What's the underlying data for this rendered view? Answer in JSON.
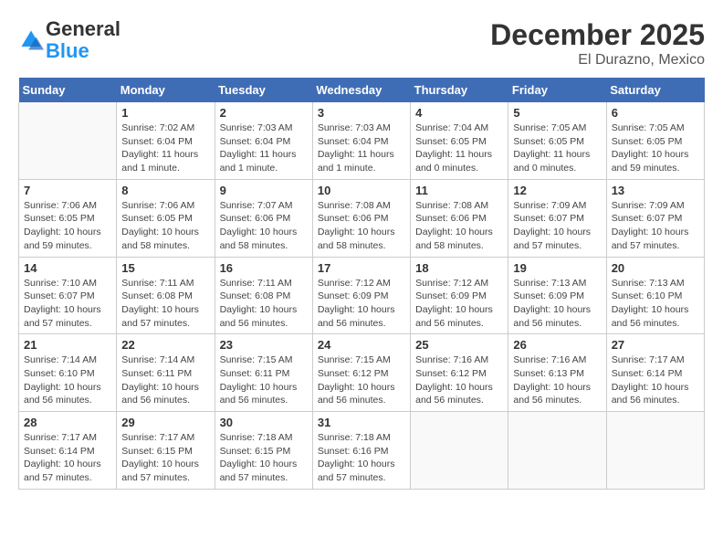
{
  "logo": {
    "general": "General",
    "blue": "Blue"
  },
  "header": {
    "month": "December 2025",
    "location": "El Durazno, Mexico"
  },
  "days_of_week": [
    "Sunday",
    "Monday",
    "Tuesday",
    "Wednesday",
    "Thursday",
    "Friday",
    "Saturday"
  ],
  "weeks": [
    [
      {
        "num": "",
        "info": ""
      },
      {
        "num": "1",
        "info": "Sunrise: 7:02 AM\nSunset: 6:04 PM\nDaylight: 11 hours\nand 1 minute."
      },
      {
        "num": "2",
        "info": "Sunrise: 7:03 AM\nSunset: 6:04 PM\nDaylight: 11 hours\nand 1 minute."
      },
      {
        "num": "3",
        "info": "Sunrise: 7:03 AM\nSunset: 6:04 PM\nDaylight: 11 hours\nand 1 minute."
      },
      {
        "num": "4",
        "info": "Sunrise: 7:04 AM\nSunset: 6:05 PM\nDaylight: 11 hours\nand 0 minutes."
      },
      {
        "num": "5",
        "info": "Sunrise: 7:05 AM\nSunset: 6:05 PM\nDaylight: 11 hours\nand 0 minutes."
      },
      {
        "num": "6",
        "info": "Sunrise: 7:05 AM\nSunset: 6:05 PM\nDaylight: 10 hours\nand 59 minutes."
      }
    ],
    [
      {
        "num": "7",
        "info": "Sunrise: 7:06 AM\nSunset: 6:05 PM\nDaylight: 10 hours\nand 59 minutes."
      },
      {
        "num": "8",
        "info": "Sunrise: 7:06 AM\nSunset: 6:05 PM\nDaylight: 10 hours\nand 58 minutes."
      },
      {
        "num": "9",
        "info": "Sunrise: 7:07 AM\nSunset: 6:06 PM\nDaylight: 10 hours\nand 58 minutes."
      },
      {
        "num": "10",
        "info": "Sunrise: 7:08 AM\nSunset: 6:06 PM\nDaylight: 10 hours\nand 58 minutes."
      },
      {
        "num": "11",
        "info": "Sunrise: 7:08 AM\nSunset: 6:06 PM\nDaylight: 10 hours\nand 58 minutes."
      },
      {
        "num": "12",
        "info": "Sunrise: 7:09 AM\nSunset: 6:07 PM\nDaylight: 10 hours\nand 57 minutes."
      },
      {
        "num": "13",
        "info": "Sunrise: 7:09 AM\nSunset: 6:07 PM\nDaylight: 10 hours\nand 57 minutes."
      }
    ],
    [
      {
        "num": "14",
        "info": "Sunrise: 7:10 AM\nSunset: 6:07 PM\nDaylight: 10 hours\nand 57 minutes."
      },
      {
        "num": "15",
        "info": "Sunrise: 7:11 AM\nSunset: 6:08 PM\nDaylight: 10 hours\nand 57 minutes."
      },
      {
        "num": "16",
        "info": "Sunrise: 7:11 AM\nSunset: 6:08 PM\nDaylight: 10 hours\nand 56 minutes."
      },
      {
        "num": "17",
        "info": "Sunrise: 7:12 AM\nSunset: 6:09 PM\nDaylight: 10 hours\nand 56 minutes."
      },
      {
        "num": "18",
        "info": "Sunrise: 7:12 AM\nSunset: 6:09 PM\nDaylight: 10 hours\nand 56 minutes."
      },
      {
        "num": "19",
        "info": "Sunrise: 7:13 AM\nSunset: 6:09 PM\nDaylight: 10 hours\nand 56 minutes."
      },
      {
        "num": "20",
        "info": "Sunrise: 7:13 AM\nSunset: 6:10 PM\nDaylight: 10 hours\nand 56 minutes."
      }
    ],
    [
      {
        "num": "21",
        "info": "Sunrise: 7:14 AM\nSunset: 6:10 PM\nDaylight: 10 hours\nand 56 minutes."
      },
      {
        "num": "22",
        "info": "Sunrise: 7:14 AM\nSunset: 6:11 PM\nDaylight: 10 hours\nand 56 minutes."
      },
      {
        "num": "23",
        "info": "Sunrise: 7:15 AM\nSunset: 6:11 PM\nDaylight: 10 hours\nand 56 minutes."
      },
      {
        "num": "24",
        "info": "Sunrise: 7:15 AM\nSunset: 6:12 PM\nDaylight: 10 hours\nand 56 minutes."
      },
      {
        "num": "25",
        "info": "Sunrise: 7:16 AM\nSunset: 6:12 PM\nDaylight: 10 hours\nand 56 minutes."
      },
      {
        "num": "26",
        "info": "Sunrise: 7:16 AM\nSunset: 6:13 PM\nDaylight: 10 hours\nand 56 minutes."
      },
      {
        "num": "27",
        "info": "Sunrise: 7:17 AM\nSunset: 6:14 PM\nDaylight: 10 hours\nand 56 minutes."
      }
    ],
    [
      {
        "num": "28",
        "info": "Sunrise: 7:17 AM\nSunset: 6:14 PM\nDaylight: 10 hours\nand 57 minutes."
      },
      {
        "num": "29",
        "info": "Sunrise: 7:17 AM\nSunset: 6:15 PM\nDaylight: 10 hours\nand 57 minutes."
      },
      {
        "num": "30",
        "info": "Sunrise: 7:18 AM\nSunset: 6:15 PM\nDaylight: 10 hours\nand 57 minutes."
      },
      {
        "num": "31",
        "info": "Sunrise: 7:18 AM\nSunset: 6:16 PM\nDaylight: 10 hours\nand 57 minutes."
      },
      {
        "num": "",
        "info": ""
      },
      {
        "num": "",
        "info": ""
      },
      {
        "num": "",
        "info": ""
      }
    ]
  ]
}
